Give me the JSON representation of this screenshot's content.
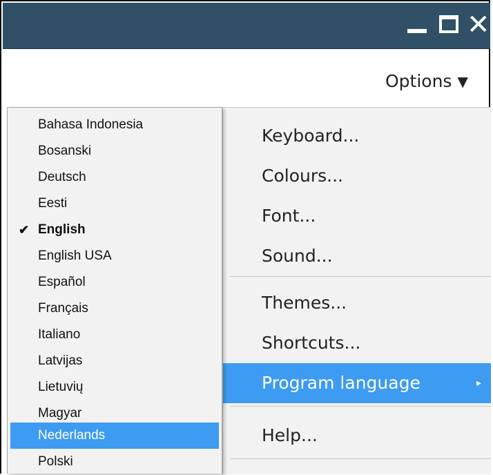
{
  "window": {
    "minimize_icon": "minimize-icon",
    "maximize_icon": "maximize-icon",
    "close_glyph": "✕"
  },
  "options": {
    "label": "Options",
    "caret": "▼"
  },
  "menu": {
    "items": [
      {
        "label": "Keyboard..."
      },
      {
        "label": "Colours..."
      },
      {
        "label": "Font..."
      },
      {
        "label": "Sound..."
      },
      {
        "label": "Themes..."
      },
      {
        "label": "Shortcuts..."
      },
      {
        "label": "Program language",
        "arrow": "▸"
      },
      {
        "label": "Help..."
      }
    ]
  },
  "languages": {
    "items": [
      {
        "label": "Bahasa Indonesia"
      },
      {
        "label": "Bosanski"
      },
      {
        "label": "Deutsch"
      },
      {
        "label": "Eesti"
      },
      {
        "label": "English",
        "check": "✔"
      },
      {
        "label": "English USA"
      },
      {
        "label": "Español"
      },
      {
        "label": "Français"
      },
      {
        "label": "Italiano"
      },
      {
        "label": "Latvijas"
      },
      {
        "label": "Lietuvių"
      },
      {
        "label": "Magyar"
      },
      {
        "label": "Nederlands"
      },
      {
        "label": "Polski"
      }
    ]
  },
  "colors": {
    "titlebar": "#2f5066",
    "highlight": "#3d9bf2"
  }
}
